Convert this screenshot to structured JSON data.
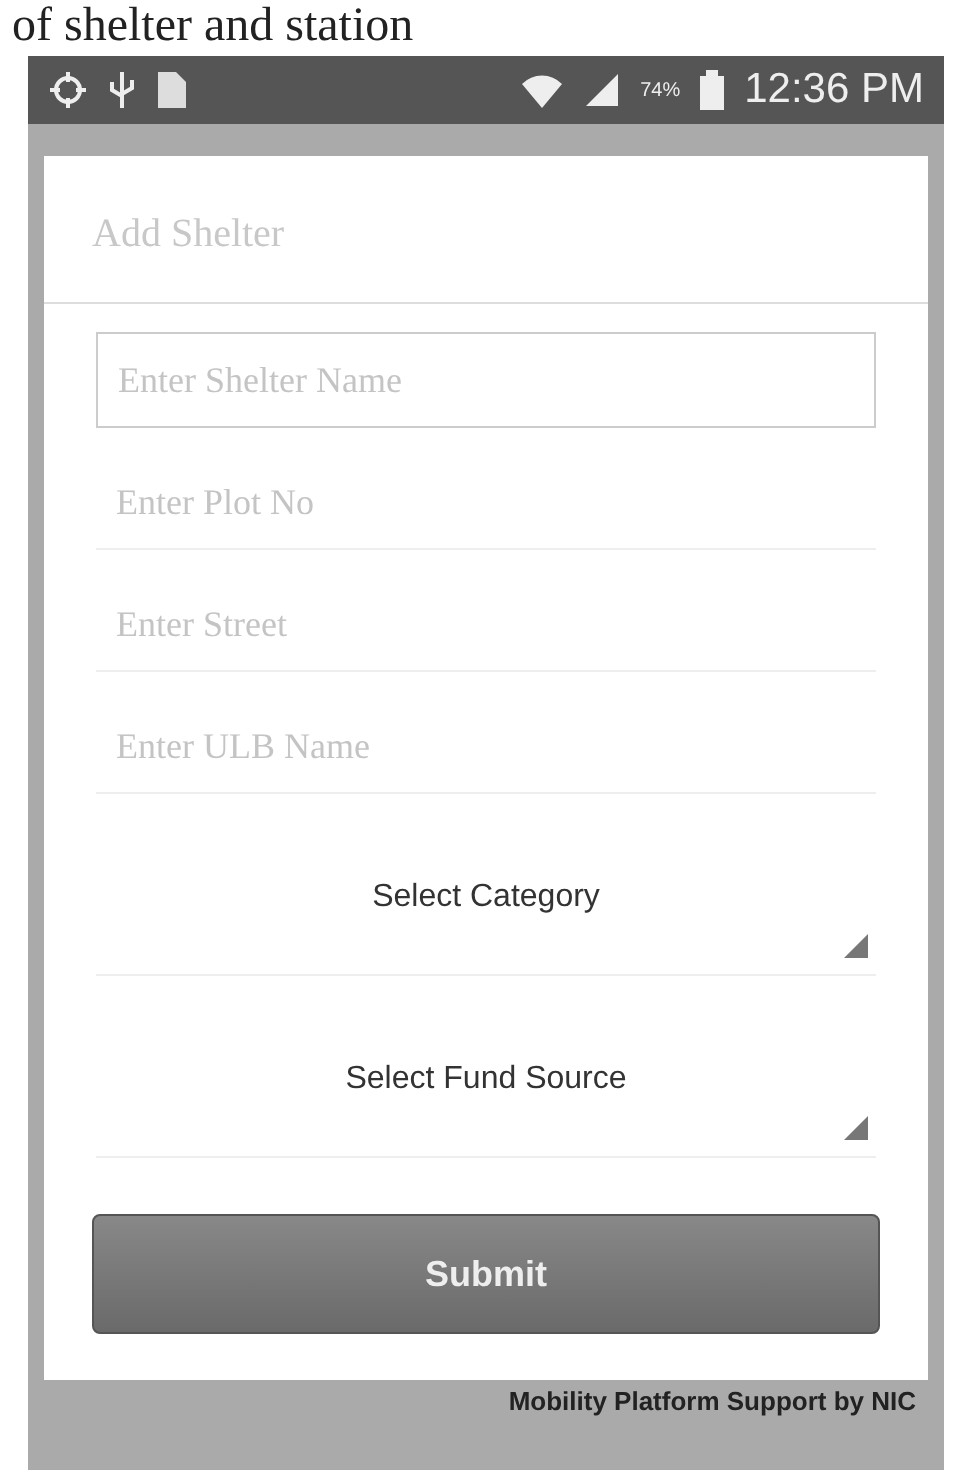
{
  "caption": "of shelter and station",
  "status_bar": {
    "battery": "74%",
    "time": "12:36 PM"
  },
  "dialog": {
    "title": "Add Shelter",
    "fields": [
      {
        "kind": "text",
        "placeholder": "Enter Shelter Name",
        "focused": true
      },
      {
        "kind": "text",
        "placeholder": "Enter Plot No",
        "focused": false
      },
      {
        "kind": "text",
        "placeholder": "Enter Street",
        "focused": false
      },
      {
        "kind": "text",
        "placeholder": "Enter ULB Name",
        "focused": false
      },
      {
        "kind": "spinner",
        "value": "Select Category"
      },
      {
        "kind": "spinner",
        "value": "Select Fund Source"
      }
    ],
    "submit": "Submit"
  },
  "footer": "Mobility Platform Support by NIC"
}
